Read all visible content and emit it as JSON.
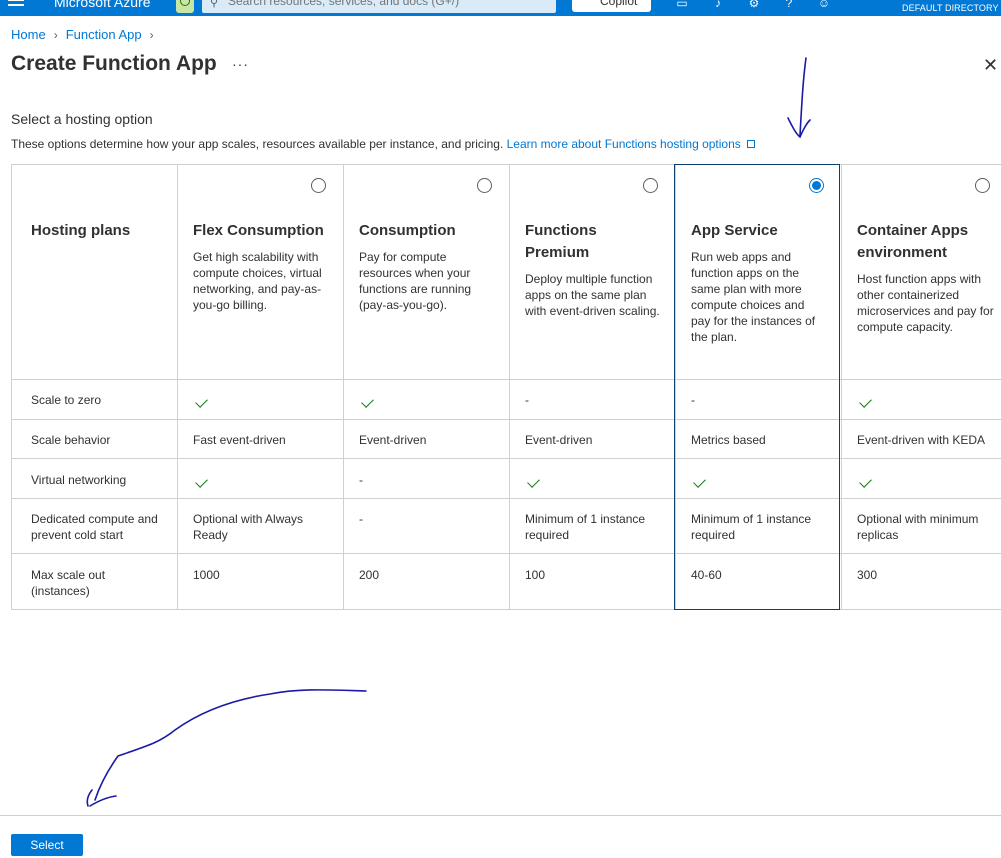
{
  "topbar": {
    "brand": "Microsoft Azure",
    "search_placeholder": "Search resources, services, and docs (G+/)",
    "copilot_label": "Copilot",
    "directory": "DEFAULT DIRECTORY",
    "accent": "#0078d4"
  },
  "breadcrumb": {
    "items": [
      "Home",
      "Function App"
    ]
  },
  "page": {
    "title": "Create Function App",
    "more": "···",
    "close": "✕",
    "section_heading": "Select a hosting option",
    "description": "These options determine how your app scales, resources available per instance, and pricing.",
    "learn_more": "Learn more about Functions hosting options"
  },
  "table": {
    "header_label": "Hosting plans",
    "row_labels": [
      "Scale to zero",
      "Scale behavior",
      "Virtual networking",
      "Dedicated compute and prevent cold start",
      "Max scale out (instances)"
    ],
    "plans": [
      {
        "title": "Flex Consumption",
        "description": "Get high scalability with compute choices, virtual networking, and pay-as-you-go billing.",
        "selected": false,
        "scale_to_zero": "check",
        "scale_behavior": "Fast event-driven",
        "virtual_networking": "check",
        "dedicated": "Optional with Always Ready",
        "max_scale": "1000"
      },
      {
        "title": "Consumption",
        "description": "Pay for compute resources when your functions are running (pay-as-you-go).",
        "selected": false,
        "scale_to_zero": "check",
        "scale_behavior": "Event-driven",
        "virtual_networking": "-",
        "dedicated": "-",
        "max_scale": "200"
      },
      {
        "title": "Functions Premium",
        "description": "Deploy multiple function apps on the same plan with event-driven scaling.",
        "selected": false,
        "scale_to_zero": "-",
        "scale_behavior": "Event-driven",
        "virtual_networking": "check",
        "dedicated": "Minimum of 1 instance required",
        "max_scale": "100"
      },
      {
        "title": "App Service",
        "description": "Run web apps and function apps on the same plan with more compute choices and pay for the instances of the plan.",
        "selected": true,
        "scale_to_zero": "-",
        "scale_behavior": "Metrics based",
        "virtual_networking": "check",
        "dedicated": "Minimum of 1 instance required",
        "max_scale": "40-60"
      },
      {
        "title": "Container Apps environment",
        "description": "Host function apps with other containerized microservices and pay for compute capacity.",
        "selected": false,
        "scale_to_zero": "check",
        "scale_behavior": "Event-driven with KEDA",
        "virtual_networking": "check",
        "dedicated": "Optional with minimum replicas",
        "max_scale": "300"
      }
    ]
  },
  "footer": {
    "select_label": "Select"
  }
}
